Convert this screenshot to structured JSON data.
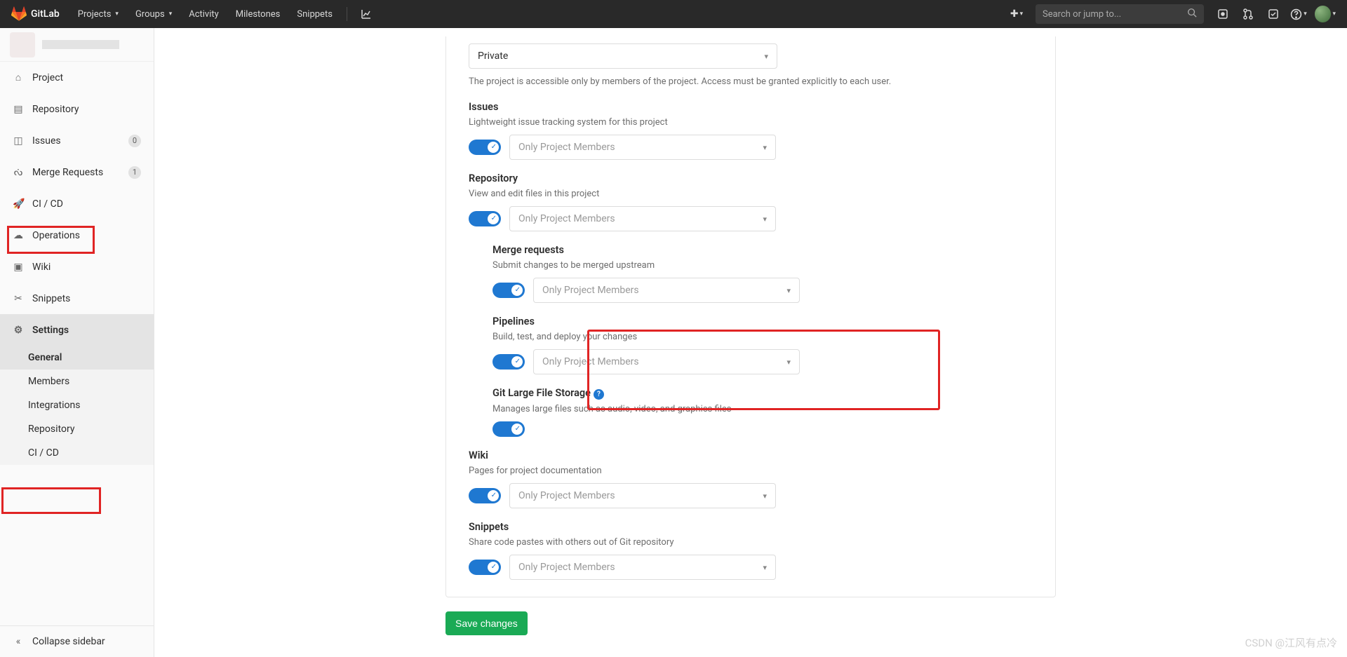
{
  "nav": {
    "brand": "GitLab",
    "links": {
      "projects": "Projects",
      "groups": "Groups",
      "activity": "Activity",
      "milestones": "Milestones",
      "snippets": "Snippets"
    },
    "search_placeholder": "Search or jump to..."
  },
  "sidebar": {
    "items": {
      "project": "Project",
      "repository": "Repository",
      "issues": "Issues",
      "issues_count": "0",
      "merge_requests": "Merge Requests",
      "mr_count": "1",
      "cicd": "CI / CD",
      "operations": "Operations",
      "wiki": "Wiki",
      "snippets": "Snippets",
      "settings": "Settings"
    },
    "settings_sub": {
      "general": "General",
      "members": "Members",
      "integrations": "Integrations",
      "repository": "Repository",
      "cicd": "CI / CD"
    },
    "collapse": "Collapse sidebar"
  },
  "visibility": {
    "value": "Private",
    "desc": "The project is accessible only by members of the project. Access must be granted explicitly to each user."
  },
  "opt_value": "Only Project Members",
  "sections": {
    "issues": {
      "title": "Issues",
      "desc": "Lightweight issue tracking system for this project"
    },
    "repository": {
      "title": "Repository",
      "desc": "View and edit files in this project"
    },
    "merge": {
      "title": "Merge requests",
      "desc": "Submit changes to be merged upstream"
    },
    "pipelines": {
      "title": "Pipelines",
      "desc": "Build, test, and deploy your changes"
    },
    "lfs": {
      "title": "Git Large File Storage",
      "desc": "Manages large files such as audio, video, and graphics files"
    },
    "wiki": {
      "title": "Wiki",
      "desc": "Pages for project documentation"
    },
    "snippets": {
      "title": "Snippets",
      "desc": "Share code pastes with others out of Git repository"
    }
  },
  "save": "Save changes",
  "watermark": "CSDN @江风有点冷"
}
